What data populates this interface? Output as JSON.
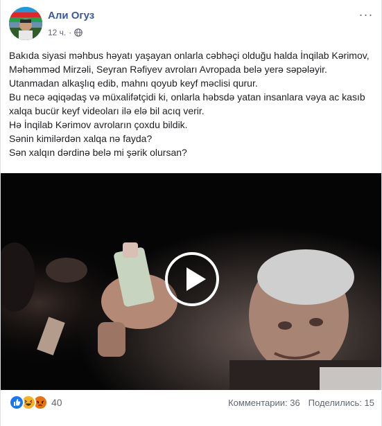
{
  "post": {
    "author": "Али Огуз",
    "time": "12 ч.",
    "dot": "·",
    "privacy_icon": "globe-icon",
    "more_icon": "ellipsis-icon",
    "more_label": "···",
    "text_lines": [
      "Bakıda siyasi məhbus həyatı yaşayan onlarla cəbhəçi olduğu halda İnqilab Kərimov, Məhəmməd Mirzəli, Seyran Rəfiyev avroları Avropada belə yerə səpələyir. Utanmadan alkaşlıq edib, mahnı qoyub keyf məclisi qurur.",
      "Bu necə əqiqədaş və müxalifətçidi ki, onlarla həbsdə yatan insanlara vəya ac kasıb xalqa bucür keyf videoları ilə elə bil acıq verir.",
      "Hə İnqilab Kərimov avroların çoxdu bildik.",
      "Sənin kimilərdən xalqa nə fayda?",
      "Sən xalqın dərdinə belə mi şərik olursan?"
    ],
    "video": {
      "play_icon": "play-icon"
    }
  },
  "footer": {
    "reactions": [
      "like",
      "haha",
      "angry"
    ],
    "reaction_count": "40",
    "comments": "Комментарии: 36",
    "shares": "Поделились: 15"
  },
  "colors": {
    "author": "#385898",
    "meta": "#606770",
    "like": "#1877f2",
    "haha": "#f7b125",
    "angry": "#e9710f"
  }
}
